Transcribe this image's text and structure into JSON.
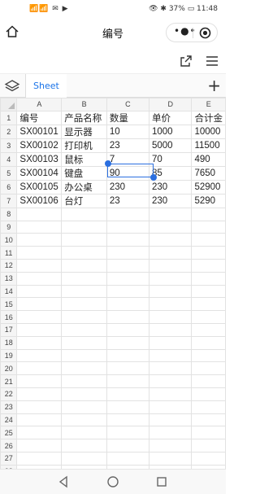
{
  "status_bar": {
    "left_icons": "📶📶 ✉ ▶",
    "right_text": "👁 ✱ 37% ▭ 11:48"
  },
  "app": {
    "title": "编号"
  },
  "sheets": [
    {
      "label": "Sheet",
      "active": true
    }
  ],
  "columns": [
    "A",
    "B",
    "C",
    "D",
    "E"
  ],
  "rows": [
    [
      "编号",
      "产品名称",
      "数量",
      "单价",
      "合计金"
    ],
    [
      "SX00101",
      "显示器",
      "10",
      "1000",
      "10000"
    ],
    [
      "SX00102",
      "打印机",
      "23",
      "5000",
      "11500"
    ],
    [
      "SX00103",
      "鼠标",
      "7",
      "70",
      "490"
    ],
    [
      "SX00104",
      "键盘",
      "90",
      "85",
      "7650"
    ],
    [
      "SX00105",
      "办公桌",
      "230",
      "230",
      "52900"
    ],
    [
      "SX00106",
      "台灯",
      "23",
      "230",
      "5290"
    ],
    [
      "",
      "",
      "",
      "",
      ""
    ],
    [
      "",
      "",
      "",
      "",
      ""
    ],
    [
      "",
      "",
      "",
      "",
      ""
    ],
    [
      "",
      "",
      "",
      "",
      ""
    ],
    [
      "",
      "",
      "",
      "",
      ""
    ],
    [
      "",
      "",
      "",
      "",
      ""
    ],
    [
      "",
      "",
      "",
      "",
      ""
    ],
    [
      "",
      "",
      "",
      "",
      ""
    ],
    [
      "",
      "",
      "",
      "",
      ""
    ],
    [
      "",
      "",
      "",
      "",
      ""
    ],
    [
      "",
      "",
      "",
      "",
      ""
    ],
    [
      "",
      "",
      "",
      "",
      ""
    ],
    [
      "",
      "",
      "",
      "",
      ""
    ],
    [
      "",
      "",
      "",
      "",
      ""
    ],
    [
      "",
      "",
      "",
      "",
      ""
    ],
    [
      "",
      "",
      "",
      "",
      ""
    ],
    [
      "",
      "",
      "",
      "",
      ""
    ],
    [
      "",
      "",
      "",
      "",
      ""
    ],
    [
      "",
      "",
      "",
      "",
      ""
    ],
    [
      "",
      "",
      "",
      "",
      ""
    ],
    [
      "",
      "",
      "",
      "",
      ""
    ]
  ],
  "selected_cell": {
    "row": 5,
    "col": "C",
    "value": "90"
  },
  "colors": {
    "accent": "#2b6fe0",
    "tab_text": "#1a73e8"
  }
}
